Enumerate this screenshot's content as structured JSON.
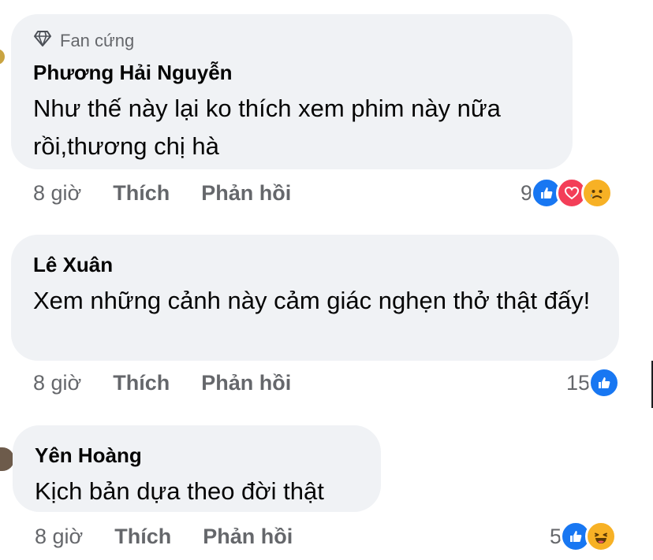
{
  "comments": [
    {
      "badge": "Fan cứng",
      "author": "Phương Hải Nguyễn",
      "text": "Như thế này lại ko thích xem phim này nữa rồi,thương chị hà",
      "time": "8 giờ",
      "like_label": "Thích",
      "reply_label": "Phản hồi",
      "reaction_count": "9",
      "reactions": [
        "like-icon",
        "love-icon",
        "sad-icon"
      ]
    },
    {
      "author": "Lê Xuân",
      "text": "Xem những cảnh này cảm giác nghẹn thở thật đấy!",
      "time": "8 giờ",
      "like_label": "Thích",
      "reply_label": "Phản hồi",
      "reaction_count": "15",
      "reactions": [
        "like-icon"
      ]
    },
    {
      "author": "Yên Hoàng",
      "text": "Kịch bản dựa theo đời thật",
      "time": "8 giờ",
      "like_label": "Thích",
      "reply_label": "Phản hồi",
      "reaction_count": "5",
      "reactions": [
        "like-icon",
        "haha-icon"
      ]
    }
  ],
  "colors": {
    "bubble": "#f0f2f5",
    "secondary_text": "#65676b",
    "like": "#1877f2",
    "love": "#f33e58",
    "emoji": "#f7b125"
  }
}
